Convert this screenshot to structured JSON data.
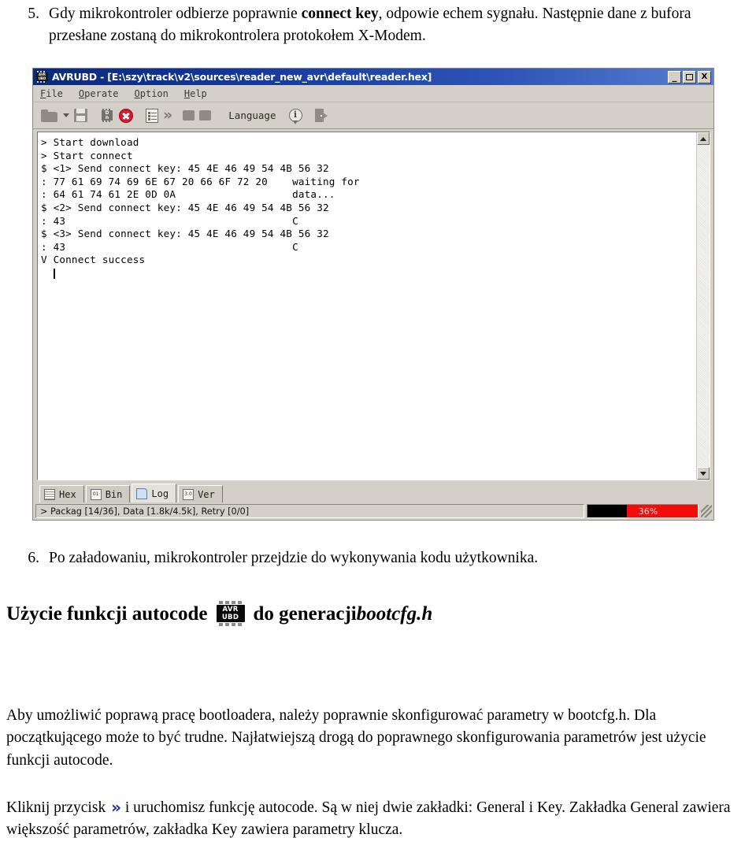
{
  "document": {
    "step5": {
      "number": "5.",
      "line1_a": "Gdy mikrokontroler odbierze poprawnie ",
      "line1_bold": "connect key",
      "line1_b": ", odpowie echem sygnału.",
      "line2": "Następnie dane z bufora przesłane zostaną do mikrokontrolera protokołem X-Modem."
    },
    "step6": {
      "number": "6.",
      "text": "Po załadowaniu, mikrokontroler przejdzie do wykonywania kodu użytkownika."
    },
    "heading_autocode": {
      "before_icon": "Użycie funkcji autocode",
      "after_icon": "do generacji ",
      "italic_part": "bootcfg.h",
      "icon_name": "avr-ubd-chip-icon",
      "icon_line1": "AVR",
      "icon_line2": "UBD"
    },
    "paragraph_aby": "Aby umożliwić poprawą pracę bootloadera, należy poprawnie skonfigurować parametry w bootcfg.h. Dla początkującego może to być trudne. Najłatwiejszą drogą do poprawnego skonfigurowania parametrów jest użycie funkcji autocode.",
    "paragraph_klik": {
      "before_icon": "Kliknij przycisk",
      "icon_glyph": "»",
      "icon_color": "#1d2f9c",
      "after_icon": "i uruchomisz funkcję autocode. Są w niej dwie zakładki: General i Key. Zakładka General zawiera większość parametrów, zakładka Key zawiera parametry klucza."
    }
  },
  "app": {
    "title": "AVRUBD - [E:\\szy\\track\\v2\\sources\\reader_new_avr\\default\\reader.hex]",
    "titlebar_icon_line1": "AVR",
    "titlebar_icon_line2": "UBD",
    "window_controls": {
      "minimize": "_",
      "maximize": "□",
      "close": "X"
    },
    "menu": [
      {
        "accel": "F",
        "rest": "ile"
      },
      {
        "accel": "O",
        "rest": "perate"
      },
      {
        "accel": "O",
        "rest": "ption"
      },
      {
        "accel": "H",
        "rest": "elp"
      }
    ],
    "toolbar": {
      "open_label": "open-folder",
      "open_dropdown_label": "open-dropdown",
      "save_label": "save",
      "chip_label": "chip",
      "chip_text_l1": "D",
      "chip_text_l2": "n",
      "stop_label": "stop",
      "list_label": "list",
      "autocode_label": "autocode",
      "square1_label": "download",
      "square2_label": "erase",
      "language_label": "Language",
      "info_label": "about",
      "exit_label": "exit"
    },
    "log_lines": [
      "> Start download",
      "> Start connect",
      "$ <1> Send connect key: 45 4E 46 49 54 4B 56 32",
      ": 77 61 69 74 69 6E 67 20 66 6F 72 20    waiting for",
      ": 64 61 74 61 2E 0D 0A                   data...",
      "$ <2> Send connect key: 45 4E 46 49 54 4B 56 32",
      ": 43                                     C",
      "$ <3> Send connect key: 45 4E 46 49 54 4B 56 32",
      ": 43                                     C",
      "V Connect success"
    ],
    "scrollbar": {
      "up_arrow": "▲",
      "down_arrow": "▼"
    },
    "tabs": [
      {
        "label": "Hex",
        "icon": "hex-grid-icon",
        "icon_text": "",
        "active": false
      },
      {
        "label": "Bin",
        "icon": "binary-icon",
        "icon_text": "01",
        "active": false
      },
      {
        "label": "Log",
        "icon": "log-page-icon",
        "icon_text": "",
        "active": true
      },
      {
        "label": "Ver",
        "icon": "version-icon",
        "icon_text": "3.0",
        "active": false
      }
    ],
    "status": {
      "text": "> Packag [14/36], Data [1.8k/4.5k], Retry [0/0]",
      "progress_label": "36%",
      "progress_percent": 36,
      "progress_bar_color": "#f20d0d",
      "progress_fill_color": "#000000"
    }
  }
}
